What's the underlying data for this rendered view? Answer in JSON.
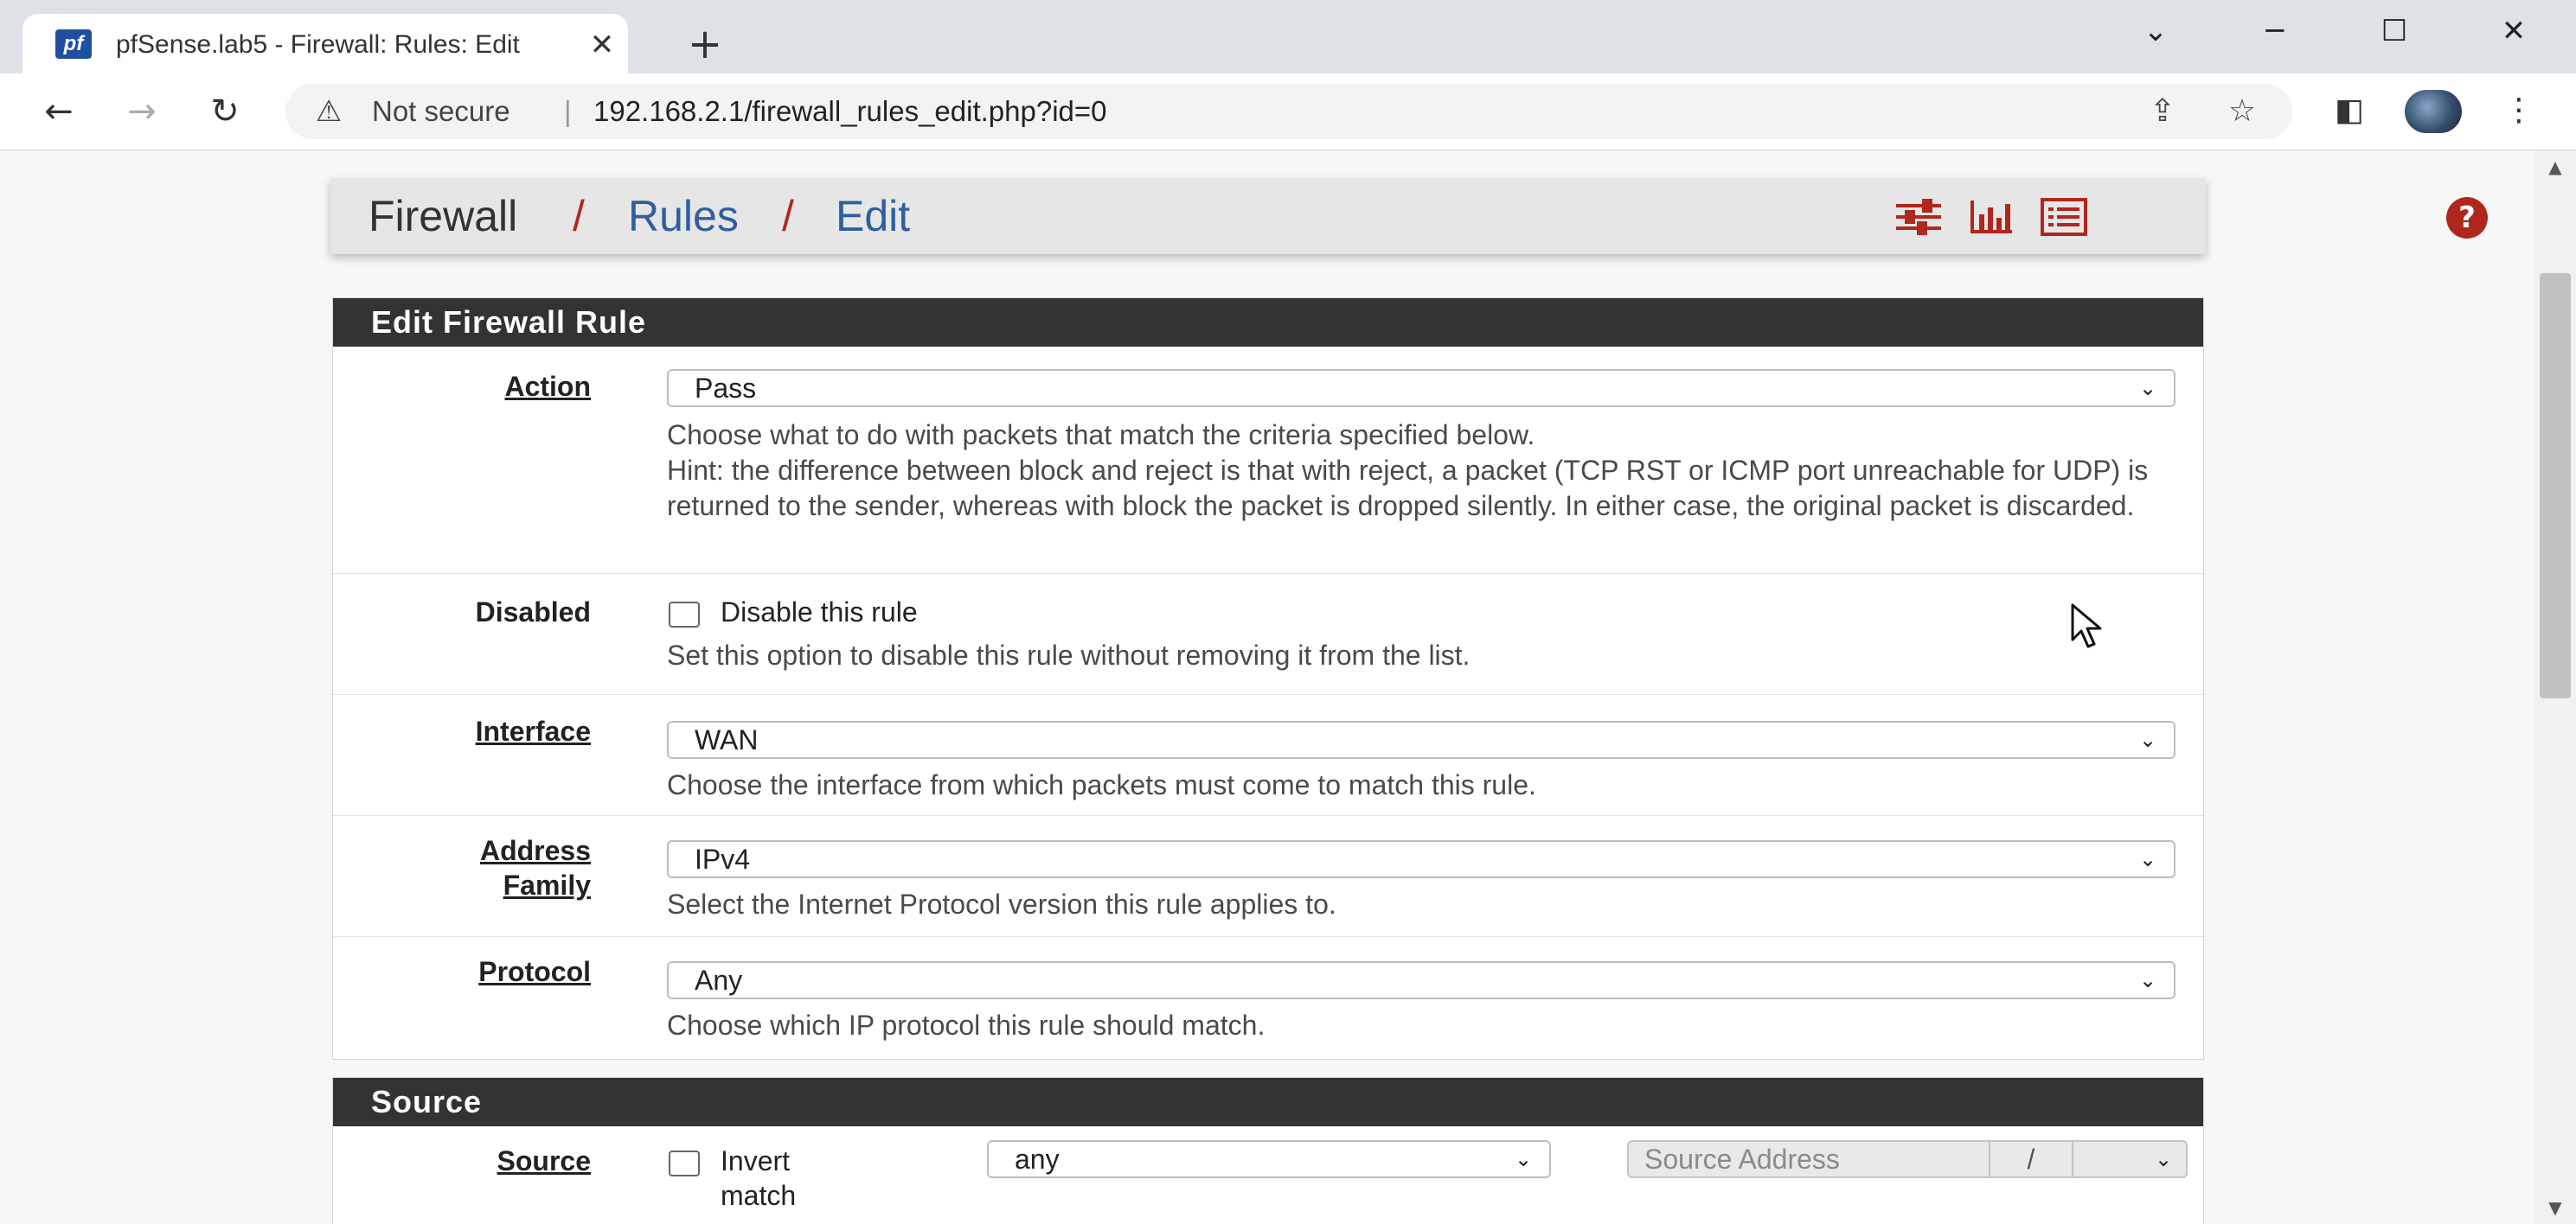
{
  "browser": {
    "tab_title": "pfSense.lab5 - Firewall: Rules: Edit",
    "tab_favicon": "pf",
    "new_tab_icon": "+",
    "close_tab_icon": "✕",
    "security_label": "Not secure",
    "url": "192.168.2.1/firewall_rules_edit.php?id=0",
    "window_controls": [
      "chevron-down-icon",
      "minimize-icon",
      "maximize-icon",
      "close-icon"
    ]
  },
  "breadcrumb": {
    "root": "Firewall",
    "sep": "/",
    "level1": "Rules",
    "level2": "Edit",
    "icons": [
      "sliders-icon",
      "bar-chart-icon",
      "list-icon",
      "help-icon"
    ],
    "accent_color": "#b0271e",
    "link_color": "#2e5f9e"
  },
  "edit_panel": {
    "title": "Edit Firewall Rule",
    "action": {
      "label": "Action",
      "value": "Pass",
      "help1": "Choose what to do with packets that match the criteria specified below.",
      "help2": "Hint: the difference between block and reject is that with reject, a packet (TCP RST or ICMP port unreachable for UDP) is returned to the sender, whereas with block the packet is dropped silently. In either case, the original packet is discarded."
    },
    "disabled": {
      "label": "Disabled",
      "checkbox_label": "Disable this rule",
      "help": "Set this option to disable this rule without removing it from the list."
    },
    "interface": {
      "label": "Interface",
      "value": "WAN",
      "help": "Choose the interface from which packets must come to match this rule."
    },
    "address_family": {
      "label_line1": "Address",
      "label_line2": "Family",
      "value": "IPv4",
      "help": "Select the Internet Protocol version this rule applies to."
    },
    "protocol": {
      "label": "Protocol",
      "value": "Any",
      "help": "Choose which IP protocol this rule should match."
    }
  },
  "source_panel": {
    "title": "Source",
    "label": "Source",
    "invert_line1": "Invert",
    "invert_line2": "match",
    "type_value": "any",
    "address_placeholder": "Source Address",
    "slash": "/"
  }
}
